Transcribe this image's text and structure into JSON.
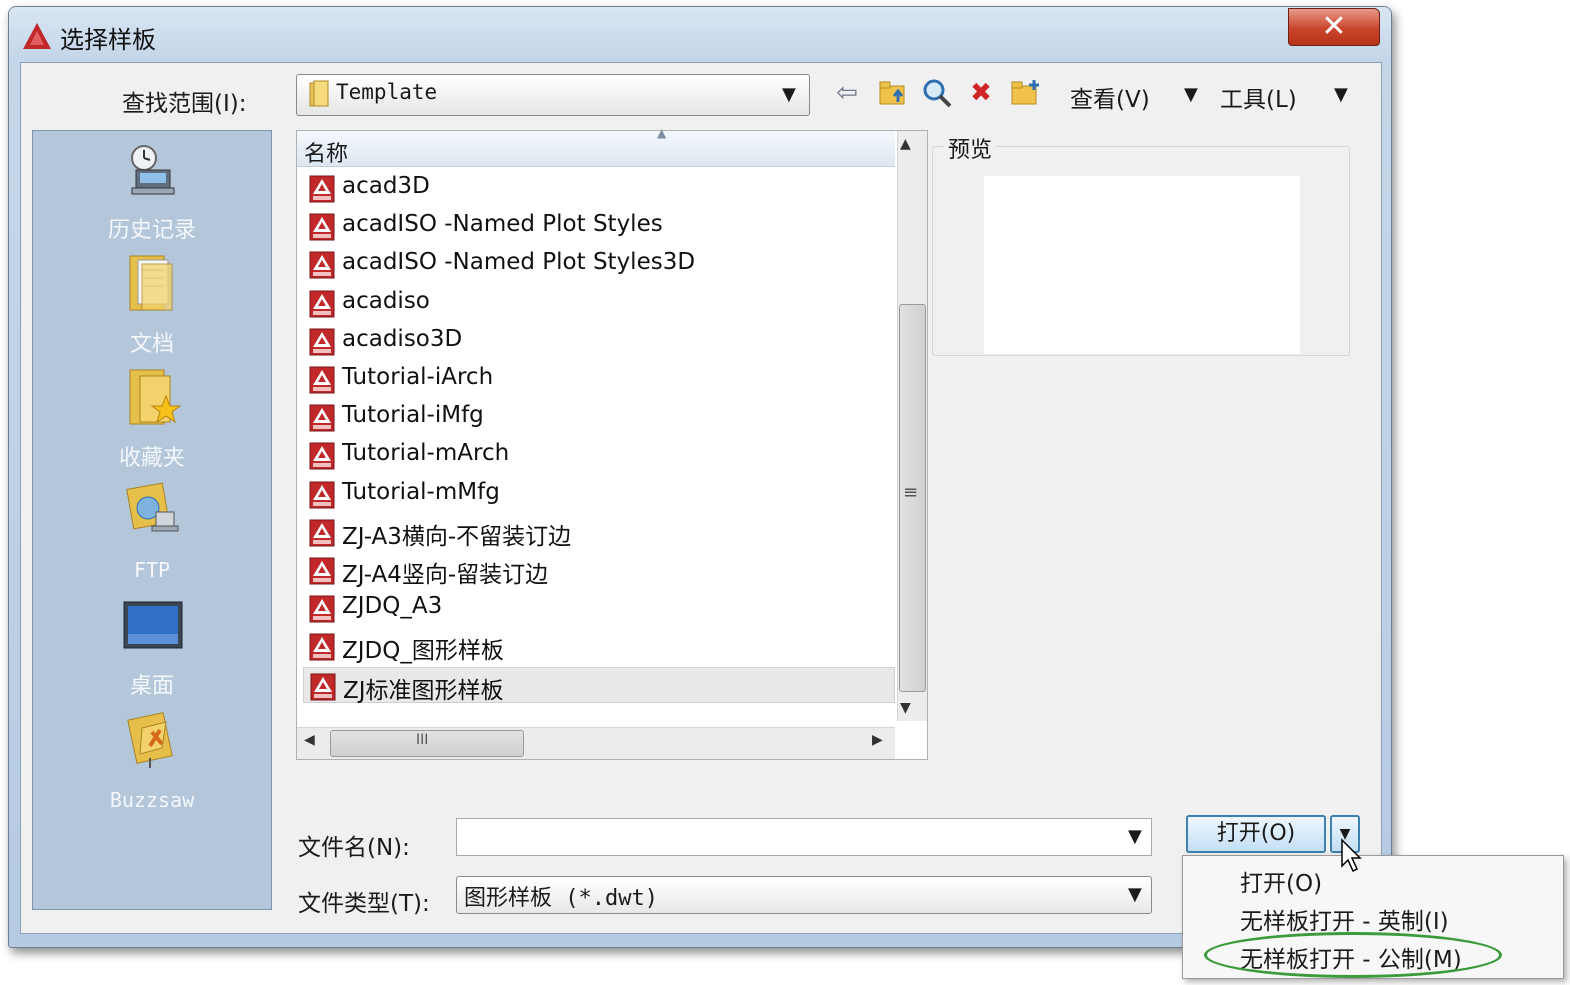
{
  "window": {
    "title": "选择样板",
    "close_label": "✕"
  },
  "toolbar": {
    "lookin_label": "查找范围(I):",
    "lookin_value": "Template",
    "icons": [
      "back-icon",
      "up-folder-icon",
      "search-web-icon",
      "delete-icon",
      "new-folder-icon"
    ],
    "views_label": "查看(V)",
    "tools_label": "工具(L)"
  },
  "places": [
    {
      "label": "历史记录",
      "icon": "history-icon"
    },
    {
      "label": "文档",
      "icon": "documents-icon"
    },
    {
      "label": "收藏夹",
      "icon": "favorites-icon"
    },
    {
      "label": "FTP",
      "icon": "ftp-icon"
    },
    {
      "label": "桌面",
      "icon": "desktop-icon"
    },
    {
      "label": "Buzzsaw",
      "icon": "buzzsaw-icon"
    }
  ],
  "file_list": {
    "column_header": "名称",
    "items": [
      "acad3D",
      "acadISO -Named Plot Styles",
      "acadISO -Named Plot Styles3D",
      "acadiso",
      "acadiso3D",
      "Tutorial-iArch",
      "Tutorial-iMfg",
      "Tutorial-mArch",
      "Tutorial-mMfg",
      "ZJ-A3横向-不留装订边",
      "ZJ-A4竖向-留装订边",
      "ZJDQ_A3",
      "ZJDQ_图形样板",
      "ZJ标准图形样板"
    ],
    "selected_index": 13,
    "scroll_grip": "≡",
    "hscroll_grip": "III"
  },
  "preview": {
    "label": "预览"
  },
  "form": {
    "filename_label": "文件名(N):",
    "filename_value": "",
    "filetype_label": "文件类型(T):",
    "filetype_value": "图形样板 (*.dwt)",
    "open_button_label": "打开(O)"
  },
  "open_menu": {
    "items": [
      "打开(O)",
      "无样板打开 - 英制(I)",
      "无样板打开 - 公制(M)"
    ],
    "highlighted_index": 2
  },
  "colors": {
    "accent": "#3c7fb1",
    "places_bg": "#b4c6da",
    "close_red": "#c9452c",
    "highlight_green": "#3b9b3b",
    "file_icon_red": "#c0282a"
  }
}
